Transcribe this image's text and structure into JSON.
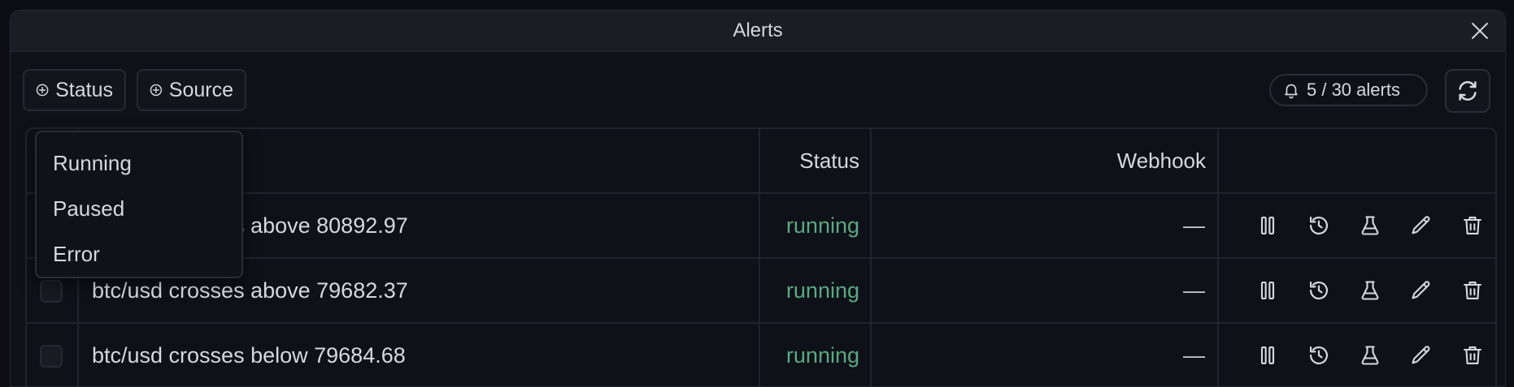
{
  "dialog": {
    "title": "Alerts"
  },
  "toolbar": {
    "status_filter_label": "Status",
    "source_filter_label": "Source",
    "alert_count": "5 / 30 alerts"
  },
  "table": {
    "columns": {
      "status": "Status",
      "webhook": "Webhook"
    },
    "rows": [
      {
        "name": "btc/usd crosses above 80892.97",
        "status": "running",
        "webhook": "—"
      },
      {
        "name": "btc/usd crosses above 79682.37",
        "status": "running",
        "webhook": "—"
      },
      {
        "name": "btc/usd crosses below 79684.68",
        "status": "running",
        "webhook": "—"
      }
    ]
  },
  "status_menu": {
    "options": [
      "Running",
      "Paused",
      "Error"
    ]
  },
  "icons": {
    "close": "close-icon",
    "add": "plus-circle-icon",
    "bell": "bell-icon",
    "refresh": "refresh-icon",
    "pause": "pause-icon",
    "history": "history-icon",
    "test": "flask-icon",
    "edit": "pencil-icon",
    "delete": "trash-icon"
  },
  "colors": {
    "background": "#0c0e13",
    "titlebar": "#1a1d24",
    "running_status": "#5ba883",
    "border": "#20242c"
  }
}
